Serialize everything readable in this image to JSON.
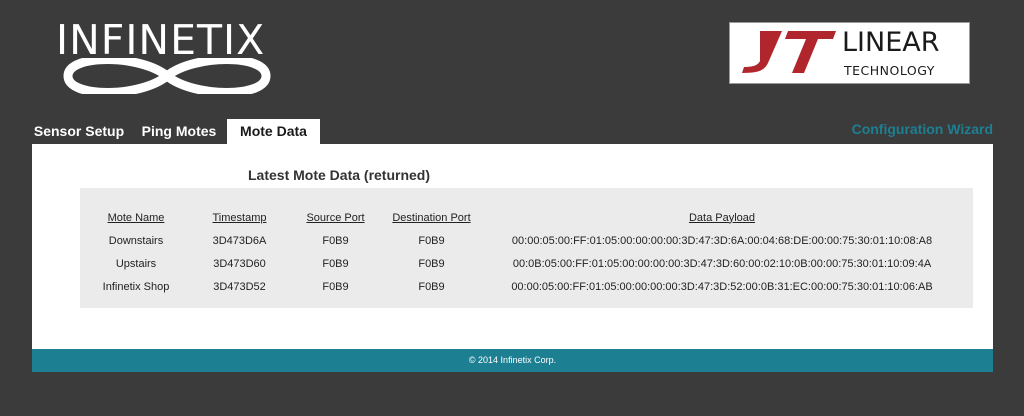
{
  "brand": {
    "left_logo_text": "INFINETIX",
    "right_logo_line1": "LINEAR",
    "right_logo_line2": "TECHNOLOGY",
    "accent_color": "#1d7f92",
    "logo_red": "#b0262c"
  },
  "nav": {
    "tabs": [
      {
        "label": "Sensor Setup",
        "active": false
      },
      {
        "label": "Ping Motes",
        "active": false
      },
      {
        "label": "Mote Data",
        "active": true
      }
    ],
    "config_link": "Configuration Wizard"
  },
  "main": {
    "title": "Latest Mote Data (returned)",
    "columns": [
      "Mote Name",
      "Timestamp",
      "Source Port",
      "Destination Port",
      "Data Payload"
    ],
    "rows": [
      [
        "Downstairs",
        "3D473D6A",
        "F0B9",
        "F0B9",
        "00:00:05:00:FF:01:05:00:00:00:00:3D:47:3D:6A:00:04:68:DE:00:00:75:30:01:10:08:A8"
      ],
      [
        "Upstairs",
        "3D473D60",
        "F0B9",
        "F0B9",
        "00:0B:05:00:FF:01:05:00:00:00:00:3D:47:3D:60:00:02:10:0B:00:00:75:30:01:10:09:4A"
      ],
      [
        "Infinetix Shop",
        "3D473D52",
        "F0B9",
        "F0B9",
        "00:00:05:00:FF:01:05:00:00:00:00:3D:47:3D:52:00:0B:31:EC:00:00:75:30:01:10:06:AB"
      ]
    ]
  },
  "footer": {
    "copyright": "© 2014 Infinetix Corp."
  }
}
